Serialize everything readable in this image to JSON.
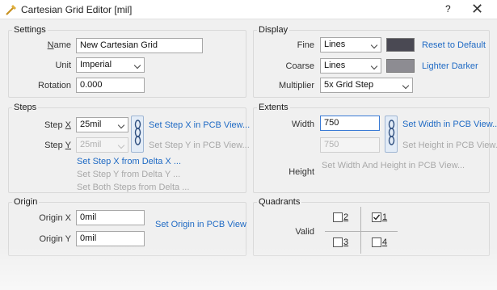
{
  "window": {
    "title": "Cartesian Grid Editor [mil]",
    "help_label": "?",
    "close_label": "✕"
  },
  "settings": {
    "legend": "Settings",
    "name_label": "Name",
    "name_value": "New Cartesian Grid",
    "unit_label": "Unit",
    "unit_value": "Imperial",
    "rotation_label": "Rotation",
    "rotation_value": "0.000"
  },
  "display": {
    "legend": "Display",
    "fine_label": "Fine",
    "fine_value": "Lines",
    "fine_color": "#4a4953",
    "coarse_label": "Coarse",
    "coarse_value": "Lines",
    "coarse_color": "#8d8c92",
    "multiplier_label": "Multiplier",
    "multiplier_value": "5x Grid Step",
    "reset_link": "Reset to Default",
    "lighter_darker_link": "Lighter Darker"
  },
  "steps": {
    "legend": "Steps",
    "stepx_label": "Step X",
    "stepx_value": "25mil",
    "stepy_label": "Step Y",
    "stepy_value": "25mil",
    "set_x_pcb_link": "Set Step X in PCB View...",
    "set_y_pcb_link": "Set Step Y in PCB View...",
    "from_delta_x": "Set Step X from Delta X ...",
    "from_delta_y": "Set Step Y from Delta Y ...",
    "both_from_delta": "Set Both Steps from Delta ..."
  },
  "extents": {
    "legend": "Extents",
    "width_label": "Width",
    "width_value": "750",
    "height_label": "Height",
    "height_value": "750",
    "set_width_link": "Set Width in PCB View...",
    "set_height_link": "Set Height in PCB View...",
    "set_both_link": "Set Width And Height in PCB View..."
  },
  "origin": {
    "legend": "Origin",
    "x_label": "Origin X",
    "x_value": "0mil",
    "y_label": "Origin Y",
    "y_value": "0mil",
    "set_origin_link": "Set Origin in PCB View"
  },
  "quadrants": {
    "legend": "Quadrants",
    "valid_label": "Valid",
    "q1": {
      "label": "1",
      "checked": true
    },
    "q2": {
      "label": "2",
      "checked": false
    },
    "q3": {
      "label": "3",
      "checked": false
    },
    "q4": {
      "label": "4",
      "checked": false
    }
  }
}
